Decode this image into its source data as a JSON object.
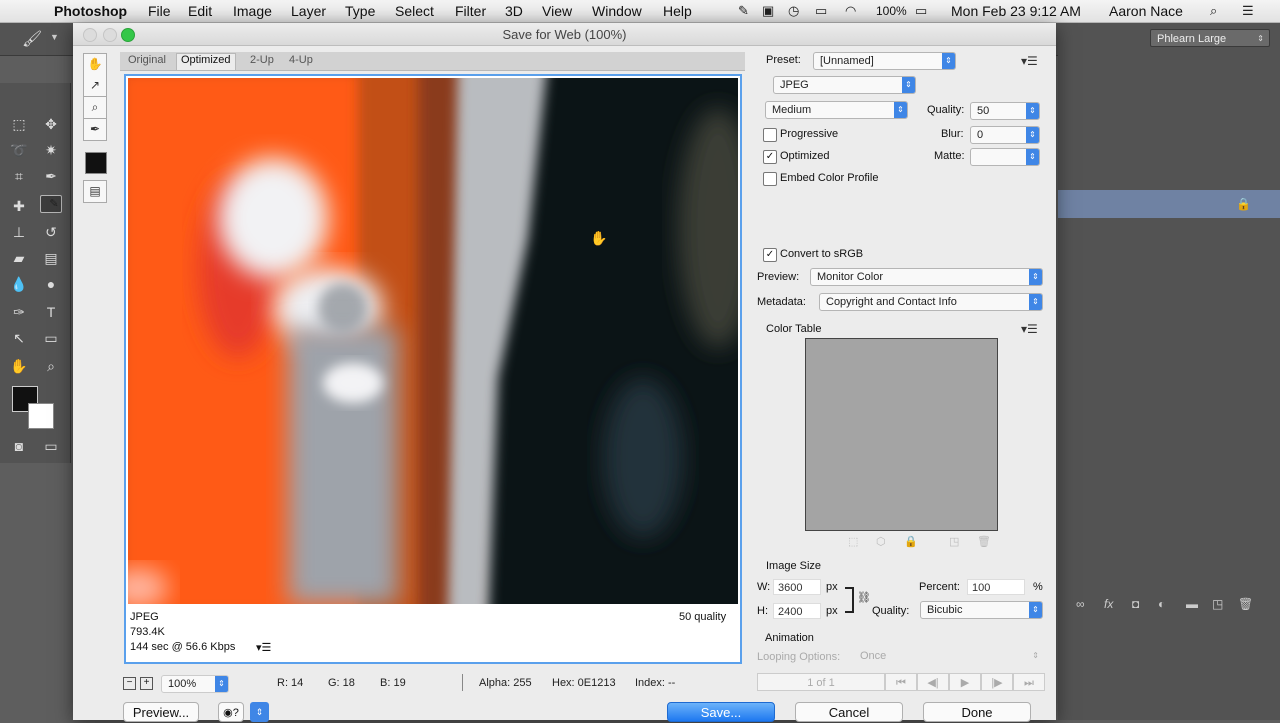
{
  "menubar": {
    "app": "Photoshop",
    "items": [
      "File",
      "Edit",
      "Image",
      "Layer",
      "Type",
      "Select",
      "Filter",
      "3D",
      "View",
      "Window",
      "Help"
    ],
    "battery": "100%",
    "datetime": "Mon Feb 23  9:12 AM",
    "user": "Aaron Nace"
  },
  "workspace": {
    "label": "Phlearn Large"
  },
  "dialog": {
    "title": "Save for Web (100%)",
    "tabs": [
      "Original",
      "Optimized",
      "2-Up",
      "4-Up"
    ],
    "active_tab": "Optimized",
    "preview_info": {
      "format": "JPEG",
      "size": "793.4K",
      "time": "144 sec @ 56.6 Kbps",
      "quality": "50 quality"
    },
    "settings": {
      "preset_label": "Preset:",
      "preset_value": "[Unnamed]",
      "format_value": "JPEG",
      "compression_value": "Medium",
      "quality_label": "Quality:",
      "quality_value": "50",
      "blur_label": "Blur:",
      "blur_value": "0",
      "matte_label": "Matte:",
      "matte_value": "",
      "progressive_label": "Progressive",
      "progressive_checked": false,
      "optimized_label": "Optimized",
      "optimized_checked": true,
      "embed_label": "Embed Color Profile",
      "embed_checked": false,
      "srgb_label": "Convert to sRGB",
      "srgb_checked": true,
      "preview_label": "Preview:",
      "preview_value": "Monitor Color",
      "metadata_label": "Metadata:",
      "metadata_value": "Copyright and Contact Info"
    },
    "color_table": {
      "label": "Color Table"
    },
    "image_size": {
      "label": "Image Size",
      "w_label": "W:",
      "w_value": "3600",
      "h_label": "H:",
      "h_value": "2400",
      "unit": "px",
      "percent_label": "Percent:",
      "percent_value": "100",
      "percent_unit": "%",
      "quality_label": "Quality:",
      "quality_value": "Bicubic"
    },
    "animation": {
      "label": "Animation",
      "looping_label": "Looping Options:",
      "looping_value": "Once",
      "frame_counter": "1 of 1"
    },
    "status": {
      "zoom": "100%",
      "r": "R: 14",
      "g": "G: 18",
      "b": "B: 19",
      "alpha": "Alpha: 255",
      "hex": "Hex: 0E1213",
      "index": "Index: --"
    },
    "buttons": {
      "preview": "Preview...",
      "save": "Save...",
      "cancel": "Cancel",
      "done": "Done"
    }
  },
  "colors": {
    "accent": "#3f86e6",
    "frame": "#5aa0ec",
    "orange": "#ff5a12"
  }
}
